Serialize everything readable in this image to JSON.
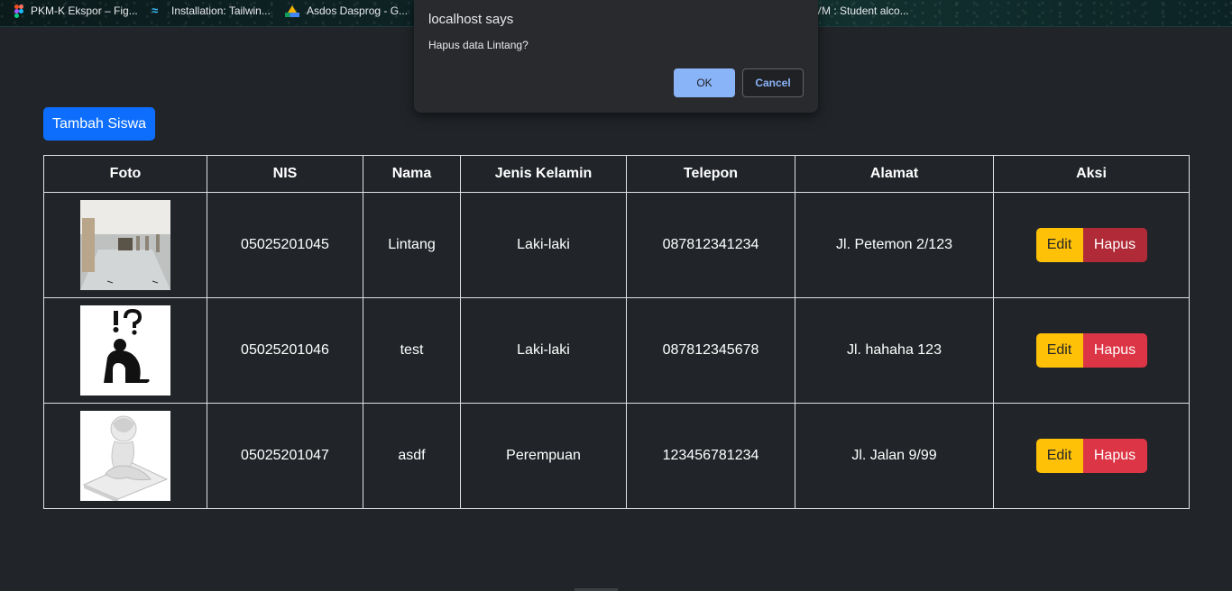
{
  "bookmarks": [
    {
      "label": "PKM-K Ekspor – Fig...",
      "icon": "figma-icon"
    },
    {
      "label": "Installation: Tailwin...",
      "icon": "tailwind-icon"
    },
    {
      "label": "Asdos Dasprog - G...",
      "icon": "google-drive-icon"
    },
    {
      "label": "VM : Student alco...",
      "icon": "bookmark-icon"
    }
  ],
  "toolbar": {
    "add_label": "Tambah Siswa"
  },
  "table": {
    "headers": [
      "Foto",
      "NIS",
      "Nama",
      "Jenis Kelamin",
      "Telepon",
      "Alamat",
      "Aksi"
    ],
    "rows": [
      {
        "nis": "05025201045",
        "nama": "Lintang",
        "jk": "Laki-laki",
        "telepon": "087812341234",
        "alamat": "Jl. Petemon 2/123",
        "photo": "hallway-photo"
      },
      {
        "nis": "05025201046",
        "nama": "test",
        "jk": "Laki-laki",
        "telepon": "087812345678",
        "alamat": "Jl. hahaha 123",
        "photo": "confused-person-silhouette"
      },
      {
        "nis": "05025201047",
        "nama": "asdf",
        "jk": "Perempuan",
        "telepon": "123456781234",
        "alamat": "Jl. Jalan 9/99",
        "photo": "stressed-figure-3d"
      }
    ],
    "edit_label": "Edit",
    "delete_label": "Hapus"
  },
  "dialog": {
    "title": "localhost says",
    "message": "Hapus data Lintang?",
    "ok_label": "OK",
    "cancel_label": "Cancel"
  },
  "colors": {
    "background": "#212529",
    "primary": "#0d6efd",
    "warning": "#ffc107",
    "danger": "#dc3545",
    "dialog_accent": "#8ab4f8"
  }
}
